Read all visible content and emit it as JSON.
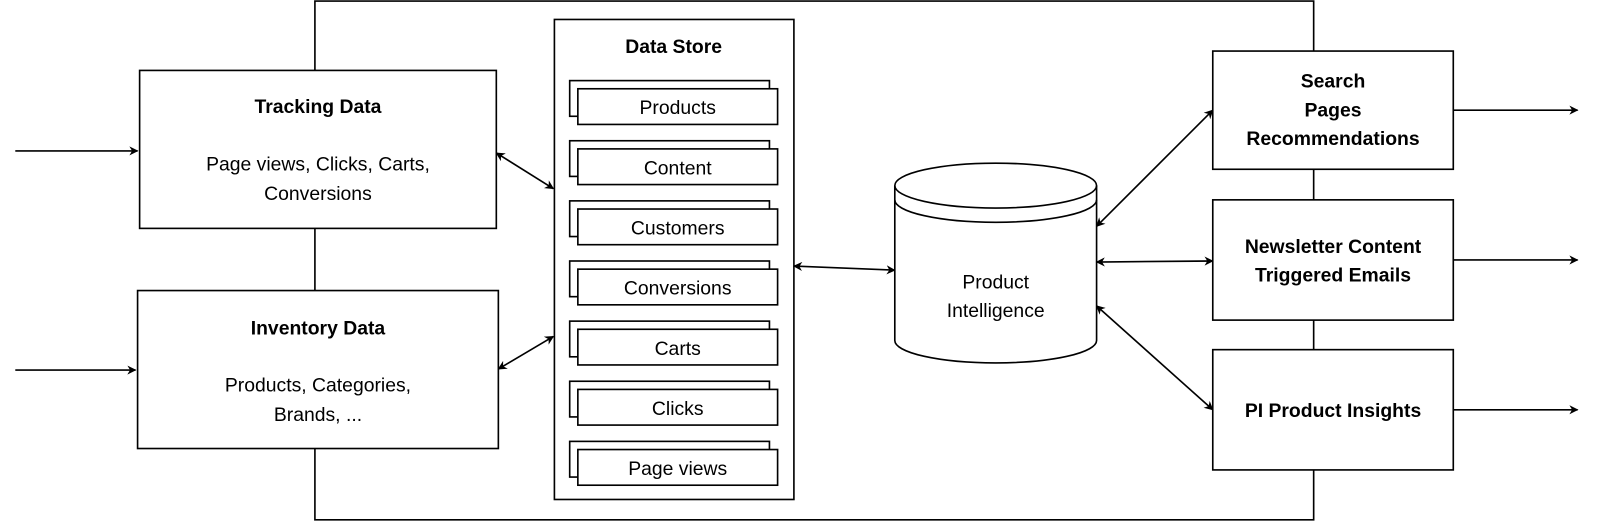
{
  "nodes": {
    "tracking": {
      "title": "Tracking Data",
      "line1": "Page views, Clicks, Carts,",
      "line2": "Conversions"
    },
    "inventory": {
      "title": "Inventory Data",
      "line1": "Products, Categories,",
      "line2": "Brands, ..."
    },
    "data_store": {
      "title": "Data Store",
      "items": [
        "Products",
        "Content",
        "Customers",
        "Conversions",
        "Carts",
        "Clicks",
        "Page views"
      ]
    },
    "product_intelligence": {
      "line1": "Product",
      "line2": "Intelligence"
    },
    "search": {
      "line1": "Search",
      "line2": "Pages",
      "line3": "Recommendations"
    },
    "newsletter": {
      "line1": "Newsletter Content",
      "line2": "Triggered Emails"
    },
    "insights": {
      "line1": "PI Product Insights"
    }
  },
  "colors": {
    "stroke": "#000000",
    "fill": "#ffffff"
  }
}
